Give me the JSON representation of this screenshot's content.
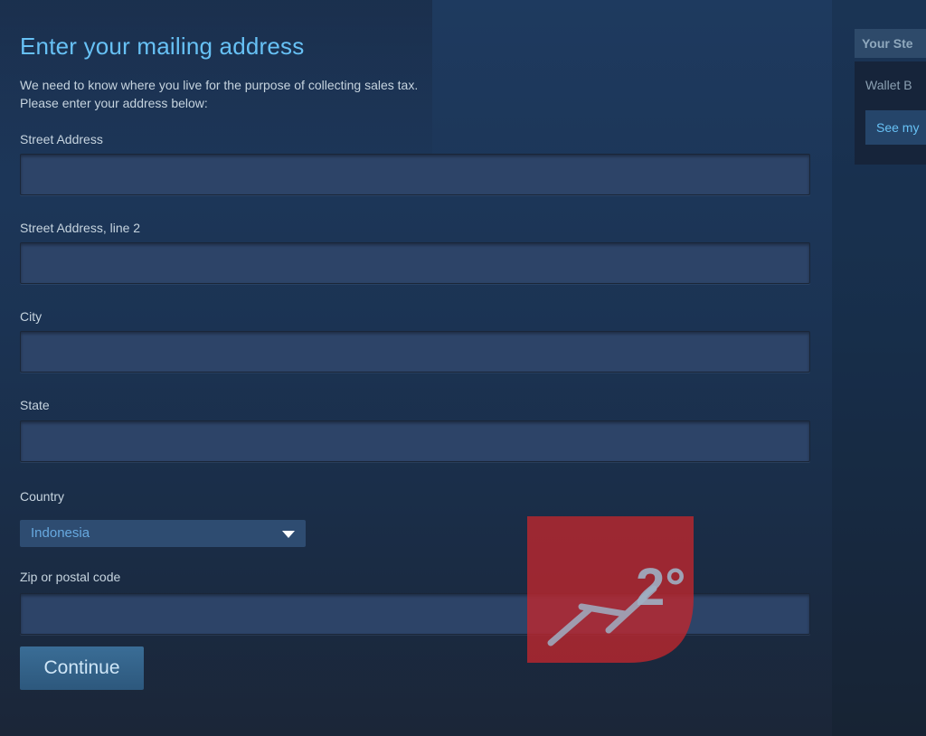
{
  "page": {
    "title": "Enter your mailing address",
    "intro_line1": "We need to know where you live for the purpose of collecting sales tax.",
    "intro_line2": "Please enter your address below:"
  },
  "form": {
    "street_label": "Street Address",
    "street_value": "",
    "street2_label": "Street Address, line 2",
    "street2_value": "",
    "city_label": "City",
    "city_value": "",
    "state_label": "State",
    "state_value": "",
    "country_label": "Country",
    "country_value": "Indonesia",
    "zip_label": "Zip or postal code",
    "zip_value": "",
    "continue_label": "Continue"
  },
  "sidebar": {
    "header": "Your Ste",
    "wallet_label": "Wallet B",
    "see_my_label": "See my"
  },
  "watermark": {
    "text": "2°"
  },
  "colors": {
    "title": "#67c1f5",
    "text": "#c6d4df",
    "input_bg": "#2d4468",
    "button_bg": "#2d587d",
    "watermark": "#c1272d"
  }
}
